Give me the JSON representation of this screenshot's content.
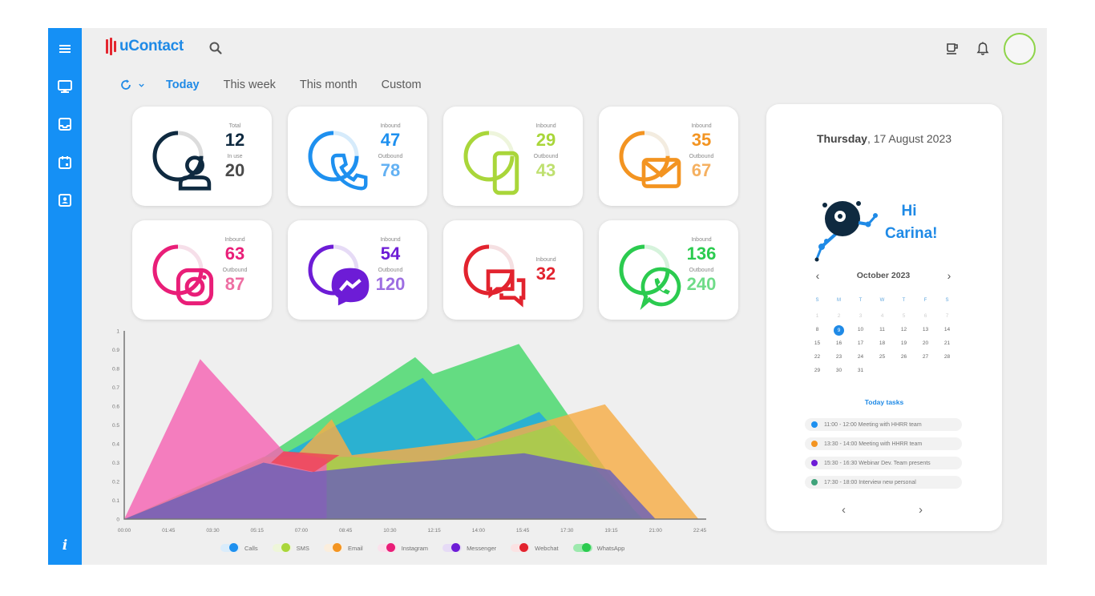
{
  "app": {
    "name": "uContact"
  },
  "colors": {
    "brand_blue": "#1f8ae6",
    "sidebar": "#1590f5",
    "logo_red": "#e3262f"
  },
  "sidebar": {
    "items": [
      {
        "name": "menu",
        "icon": "hamburger-icon"
      },
      {
        "name": "monitor",
        "icon": "monitor-icon"
      },
      {
        "name": "inbox",
        "icon": "inbox-icon"
      },
      {
        "name": "calendar",
        "icon": "calendar-icon"
      },
      {
        "name": "contacts",
        "icon": "contact-card-icon"
      }
    ],
    "info_label": "i"
  },
  "header": {
    "icons": [
      "search-icon",
      "break-cup-icon",
      "bell-icon",
      "avatar"
    ]
  },
  "filters": {
    "tabs": [
      {
        "label": "Today",
        "active": true
      },
      {
        "label": "This week",
        "active": false
      },
      {
        "label": "This month",
        "active": false
      },
      {
        "label": "Custom",
        "active": false
      }
    ]
  },
  "cards": [
    {
      "channel": "agents",
      "icon": "user-icon",
      "color": "#0f2a40",
      "track": "#dcdcdc",
      "label1": "Total",
      "value1": "12",
      "label2": "In use",
      "value2": "20",
      "value2_color": "#4a4a4a",
      "ring_fraction": 0.75
    },
    {
      "channel": "calls",
      "icon": "phone-icon",
      "color": "#1e90ef",
      "track": "#d6ebfb",
      "label1": "Inbound",
      "value1": "47",
      "label2": "Outbound",
      "value2": "78",
      "value2_color": "#63b1f3",
      "ring_fraction": 0.75
    },
    {
      "channel": "sms",
      "icon": "mobile-icon",
      "color": "#a9d63a",
      "track": "#eef5dc",
      "label1": "Inbound",
      "value1": "29",
      "label2": "Outbound",
      "value2": "43",
      "value2_color": "#bfe070",
      "ring_fraction": 0.75
    },
    {
      "channel": "email",
      "icon": "envelope-icon",
      "color": "#f39421",
      "track": "#f3ece0",
      "label1": "Inbound",
      "value1": "35",
      "label2": "Outbound",
      "value2": "67",
      "value2_color": "#f5b060",
      "ring_fraction": 0.75
    },
    {
      "channel": "instagram",
      "icon": "instagram-icon",
      "color": "#e91e78",
      "track": "#f6dfe9",
      "label1": "Inbound",
      "value1": "63",
      "label2": "Outbound",
      "value2": "87",
      "value2_color": "#ee6fa3",
      "ring_fraction": 0.75
    },
    {
      "channel": "messenger",
      "icon": "messenger-icon",
      "color": "#6d1cd6",
      "track": "#e6dbf6",
      "label1": "Inbound",
      "value1": "54",
      "label2": "Outbound",
      "value2": "120",
      "value2_color": "#9d6ee2",
      "ring_fraction": 0.75
    },
    {
      "channel": "webchat",
      "icon": "chat-bubbles-icon",
      "color": "#e2232e",
      "track": "#f5e0e2",
      "label1": "Inbound",
      "value1": "32",
      "label2": null,
      "value2": null,
      "value2_color": null,
      "ring_fraction": 0.75
    },
    {
      "channel": "whatsapp",
      "icon": "whatsapp-icon",
      "color": "#2bcb4f",
      "track": "#d6f3dc",
      "label1": "Inbound",
      "value1": "136",
      "label2": "Outbound",
      "value2": "240",
      "value2_color": "#6fdc88",
      "ring_fraction": 0.75
    }
  ],
  "chart_data": {
    "type": "area",
    "title": "",
    "xlabel": "",
    "ylabel": "",
    "ylim": [
      0,
      1
    ],
    "xlim_hours": [
      0,
      22.75
    ],
    "x_tick_labels": [
      "00:00",
      "01:45",
      "03:30",
      "05:15",
      "07:00",
      "08:45",
      "10:30",
      "12:15",
      "14:00",
      "15:45",
      "17:30",
      "19:15",
      "21:00",
      "22:45"
    ],
    "y_tick_labels": [
      "0",
      "0.1",
      "0.2",
      "0.3",
      "0.4",
      "0.5",
      "0.6",
      "0.7",
      "0.8",
      "0.9",
      "1"
    ],
    "grid": false,
    "legend_position": "bottom",
    "series": [
      {
        "name": "WhatsApp",
        "color": "#46d86a",
        "points": [
          [
            0,
            0
          ],
          [
            5.2,
            0.3
          ],
          [
            11.5,
            0.86
          ],
          [
            12.2,
            0.77
          ],
          [
            15.6,
            0.93
          ],
          [
            20.4,
            0
          ]
        ]
      },
      {
        "name": "Calls",
        "color": "#1ea7e3",
        "points": [
          [
            0,
            0
          ],
          [
            5.0,
            0.25
          ],
          [
            11.8,
            0.75
          ],
          [
            13.9,
            0.42
          ],
          [
            16.4,
            0.57
          ],
          [
            20.2,
            0
          ]
        ]
      },
      {
        "name": "Email",
        "color": "#f6ad47",
        "points": [
          [
            0,
            0
          ],
          [
            6.6,
            0.31
          ],
          [
            8.2,
            0.53
          ],
          [
            9.0,
            0.34
          ],
          [
            14.0,
            0.42
          ],
          [
            19.0,
            0.61
          ],
          [
            22.7,
            0
          ]
        ]
      },
      {
        "name": "SMS",
        "color": "#a3cf4a",
        "points": [
          [
            0,
            0
          ],
          [
            5.5,
            0.33
          ],
          [
            9.0,
            0.33
          ],
          [
            12.0,
            0.3
          ],
          [
            17.0,
            0.5
          ],
          [
            20.5,
            0
          ]
        ]
      },
      {
        "name": "Instagram",
        "color": "#f564b3",
        "points": [
          [
            0,
            0
          ],
          [
            3.0,
            0.85
          ],
          [
            6.3,
            0.36
          ],
          [
            7.2,
            0.34
          ],
          [
            8.0,
            0.32
          ]
        ]
      },
      {
        "name": "Webchat",
        "color": "#ef4456",
        "points": [
          [
            5.8,
            0.3
          ],
          [
            6.3,
            0.36
          ],
          [
            8.5,
            0.34
          ],
          [
            7.5,
            0.25
          ],
          [
            5.8,
            0.3
          ]
        ]
      },
      {
        "name": "Messenger",
        "color": "#6a60b8",
        "points": [
          [
            0,
            0
          ],
          [
            5.5,
            0.3
          ],
          [
            7.4,
            0.25
          ],
          [
            10.3,
            0.29
          ],
          [
            15.8,
            0.35
          ],
          [
            19.2,
            0.26
          ],
          [
            21.0,
            0
          ]
        ]
      }
    ],
    "legend": [
      {
        "name": "Calls",
        "color": "#1e90ef",
        "track": "#d9ecfb"
      },
      {
        "name": "SMS",
        "color": "#a9d63a",
        "track": "#eef6d9"
      },
      {
        "name": "Email",
        "color": "#f39421",
        "track": "#fbeedd"
      },
      {
        "name": "Instagram",
        "color": "#e91e78",
        "track": "#fbe1ec"
      },
      {
        "name": "Messenger",
        "color": "#6d1cd6",
        "track": "#e6dbf6"
      },
      {
        "name": "Webchat",
        "color": "#e2232e",
        "track": "#fbe2e3"
      },
      {
        "name": "WhatsApp",
        "color": "#2bcb4f",
        "track": "#9de9ae"
      }
    ]
  },
  "right_panel": {
    "date_day": "Thursday",
    "date_rest": ", 17 August 2023",
    "greeting_line1": "Hi",
    "greeting_line2": "Carina!",
    "calendar": {
      "month_label": "October 2023",
      "prev": "‹",
      "next": "›",
      "weekdays": [
        "S",
        "M",
        "T",
        "W",
        "T",
        "F",
        "S"
      ],
      "faded_days": [
        "1",
        "2",
        "3",
        "4",
        "5",
        "6",
        "7"
      ],
      "days": [
        "8",
        "9",
        "10",
        "11",
        "12",
        "13",
        "14",
        "15",
        "16",
        "17",
        "18",
        "19",
        "20",
        "21",
        "22",
        "23",
        "24",
        "25",
        "26",
        "27",
        "28",
        "29",
        "30",
        "31"
      ],
      "selected_day": "9"
    },
    "tasks_title": "Today tasks",
    "tasks": [
      {
        "text": "11:00 - 12:00 Meeting with HHRR team",
        "color": "#1e90ef"
      },
      {
        "text": "13:30 - 14:00 Meeting with HHRR team",
        "color": "#f39421"
      },
      {
        "text": "15:30 - 16:30 Webinar Dev. Team presents",
        "color": "#6d1cd6"
      },
      {
        "text": "17:30 - 18:00 Interview new personal",
        "color": "#3fa37a"
      }
    ],
    "tasks_prev": "‹",
    "tasks_next": "›"
  }
}
